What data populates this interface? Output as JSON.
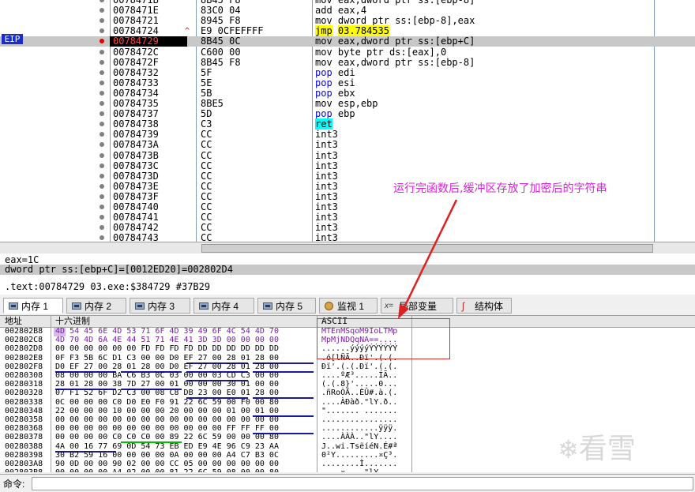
{
  "cpu": {
    "eip_label": "EIP",
    "rows": [
      {
        "addr": "0078471B",
        "hex": "8B45 F8",
        "dis_mnem": "mov",
        "dis_ops": "eax,dword ptr ss:[ebp-8]",
        "partial": true
      },
      {
        "addr": "0078471E",
        "hex": "83C0 04",
        "dis_mnem": "add",
        "dis_ops": "eax,4"
      },
      {
        "addr": "00784721",
        "hex": "8945 F8",
        "dis_mnem": "mov",
        "dis_ops": "dword ptr ss:[ebp-8],eax"
      },
      {
        "addr": "00784724",
        "hex": "E9 0CFEFFFF",
        "dis_mnem": "jmp",
        "dis_ops": "03.784535",
        "marker": "^"
      },
      {
        "addr": "00784729",
        "hex": "8B45 0C",
        "dis_mnem": "mov",
        "dis_ops": "eax,dword ptr ss:[ebp+C]",
        "current": true
      },
      {
        "addr": "0078472C",
        "hex": "C600 00",
        "dis_mnem": "mov",
        "dis_ops": "byte ptr ds:[eax],0"
      },
      {
        "addr": "0078472F",
        "hex": "8B45 F8",
        "dis_mnem": "mov",
        "dis_ops": "eax,dword ptr ss:[ebp-8]"
      },
      {
        "addr": "00784732",
        "hex": "5F",
        "dis_mnem": "pop",
        "dis_ops": "edi"
      },
      {
        "addr": "00784733",
        "hex": "5E",
        "dis_mnem": "pop",
        "dis_ops": "esi"
      },
      {
        "addr": "00784734",
        "hex": "5B",
        "dis_mnem": "pop",
        "dis_ops": "ebx"
      },
      {
        "addr": "00784735",
        "hex": "8BE5",
        "dis_mnem": "mov",
        "dis_ops": "esp,ebp"
      },
      {
        "addr": "00784737",
        "hex": "5D",
        "dis_mnem": "pop",
        "dis_ops": "ebp"
      },
      {
        "addr": "00784738",
        "hex": "C3",
        "dis_mnem": "ret",
        "dis_ops": ""
      },
      {
        "addr": "00784739",
        "hex": "CC",
        "dis_mnem": "int3",
        "dis_ops": ""
      },
      {
        "addr": "0078473A",
        "hex": "CC",
        "dis_mnem": "int3",
        "dis_ops": ""
      },
      {
        "addr": "0078473B",
        "hex": "CC",
        "dis_mnem": "int3",
        "dis_ops": ""
      },
      {
        "addr": "0078473C",
        "hex": "CC",
        "dis_mnem": "int3",
        "dis_ops": ""
      },
      {
        "addr": "0078473D",
        "hex": "CC",
        "dis_mnem": "int3",
        "dis_ops": ""
      },
      {
        "addr": "0078473E",
        "hex": "CC",
        "dis_mnem": "int3",
        "dis_ops": ""
      },
      {
        "addr": "0078473F",
        "hex": "CC",
        "dis_mnem": "int3",
        "dis_ops": ""
      },
      {
        "addr": "00784740",
        "hex": "CC",
        "dis_mnem": "int3",
        "dis_ops": ""
      },
      {
        "addr": "00784741",
        "hex": "CC",
        "dis_mnem": "int3",
        "dis_ops": ""
      },
      {
        "addr": "00784742",
        "hex": "CC",
        "dis_mnem": "int3",
        "dis_ops": ""
      },
      {
        "addr": "00784743",
        "hex": "CC",
        "dis_mnem": "int3",
        "dis_ops": ""
      }
    ]
  },
  "info": {
    "line1": "eax=1C",
    "line2": "dword ptr ss:[ebp+C]=[0012ED20]=002802D4",
    "line3": ".text:00784729 03.exe:$384729 #37B29"
  },
  "tabs": [
    {
      "label": "内存 1",
      "icon": "memory-icon",
      "active": true
    },
    {
      "label": "内存 2",
      "icon": "memory-icon"
    },
    {
      "label": "内存 3",
      "icon": "memory-icon"
    },
    {
      "label": "内存 4",
      "icon": "memory-icon"
    },
    {
      "label": "内存 5",
      "icon": "memory-icon"
    },
    {
      "label": "监视 1",
      "icon": "watch-icon"
    },
    {
      "label": "局部变量",
      "icon": "local-var-icon"
    },
    {
      "label": "结构体",
      "icon": "struct-icon"
    }
  ],
  "dump": {
    "col_addr": "地址",
    "col_hex": "十六进制",
    "col_ascii": "ASCII",
    "rows": [
      {
        "addr": "002802B8",
        "hex": "4D 54 45 6E 4D 53 71 6F 4D 39 49 6F 4C 54 4D 70",
        "ascii": "MTEnMSqoM9IoLTMp"
      },
      {
        "addr": "002802C8",
        "hex": "4D 70 4D 6A 4E 44 51 71 4E 41 3D 3D 00 00 00 00",
        "ascii": "MpMjNDQqNA==...."
      },
      {
        "addr": "002802D8",
        "hex": "00 00 00 00 00 00 FD FD FD FD DD DD DD DD DD DD",
        "ascii": "......ýýýýÝÝÝÝÝÝ"
      },
      {
        "addr": "002802E8",
        "hex": "0F F3 5B 6C D1 C3 00 00 D0 EF 27 00 28 01 28 00",
        "ascii": ".ó[lÑÃ..Ðï'.(.(."
      },
      {
        "addr": "002802F8",
        "hex": "D0 EF 27 00 28 01 28 00 D0 EF 27 00 28 01 28 00",
        "ascii": "Ðï'.(.(.Ðï'.(.(."
      },
      {
        "addr": "00280308",
        "hex": "08 00 00 00 BA C6 B3 0C 03 00 00 03 CD C3 00 00",
        "ascii": "....ºÆ³.....ÍÃ.."
      },
      {
        "addr": "00280318",
        "hex": "28 01 28 00 38 7D 27 00 01 00 00 00 30 01 00 00",
        "ascii": "(.(.8}'.....0..."
      },
      {
        "addr": "00280328",
        "hex": "07 F1 52 6F D2 C3 00 08 C8 DB 23 00 E0 01 28 00",
        "ascii": ".ñRoÒÃ..ÈÛ#.à.(."
      },
      {
        "addr": "00280338",
        "hex": "0C 00 00 00 C0 D0 E0 F0 91 22 6C 59 00 F0 00 80",
        "ascii": "....ÀÐàð.\"lY.ð.."
      },
      {
        "addr": "00280348",
        "hex": "22 00 00 00 10 00 00 00 20 00 00 00 01 00 01 00",
        "ascii": "\"....... ......."
      },
      {
        "addr": "00280358",
        "hex": "00 00 00 00 00 00 00 00 00 00 00 00 00 00 00 00",
        "ascii": "................"
      },
      {
        "addr": "00280368",
        "hex": "00 00 00 00 00 00 00 00 00 00 00 00 FF FF FF 00",
        "ascii": "............ÿÿÿ."
      },
      {
        "addr": "00280378",
        "hex": "00 00 00 00 C0 C0 C0 00 89 22 6C 59 00 00 00 80",
        "ascii": "....ÀÀÀ..\"lY...."
      },
      {
        "addr": "00280388",
        "hex": "4A 00 16 77 69 0D 54 73 EB ED E9 4E 96 C9 23 AA",
        "ascii": "J..wi.TsëíéN.É#ª"
      },
      {
        "addr": "00280398",
        "hex": "30 B2 59 16 00 00 00 00 0A 00 00 00 A4 C7 B3 0C",
        "ascii": "0²Y.........¤Ç³."
      },
      {
        "addr": "002803A8",
        "hex": "90 0D 00 00 90 02 00 00 CC 05 00 00 00 00 00 00",
        "ascii": "........Ì......."
      },
      {
        "addr": "002803B8",
        "hex": "00 00 00 00 A4 02 00 00 81 22 6C 59 08 00 00 80",
        "ascii": "....¤....\"lY...."
      }
    ]
  },
  "annotation": "运行完函数后,缓冲区存放了加密后的字符串",
  "command": {
    "label": "命令:",
    "value": ""
  },
  "watermark": "看雪",
  "colors": {
    "annotation": "#e020e0",
    "eip_badge": "#1a2dc8",
    "arrow": "#e02020"
  }
}
